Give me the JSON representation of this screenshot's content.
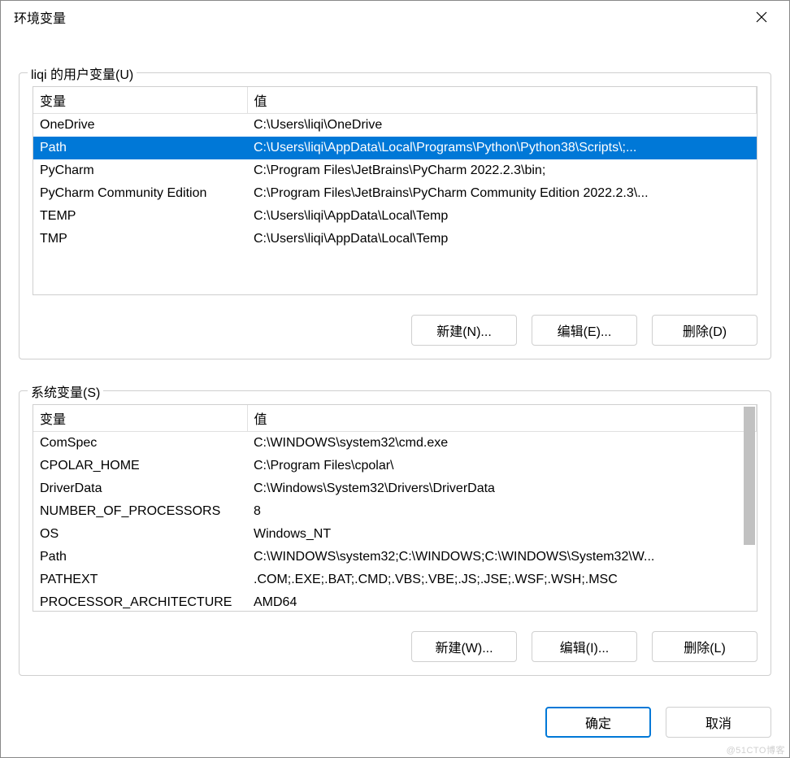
{
  "window": {
    "title": "环境变量",
    "close_icon": "close-icon"
  },
  "user_section": {
    "legend": "liqi 的用户变量(U)",
    "columns": {
      "variable": "变量",
      "value": "值"
    },
    "rows": [
      {
        "variable": "OneDrive",
        "value": "C:\\Users\\liqi\\OneDrive",
        "selected": false
      },
      {
        "variable": "Path",
        "value": "C:\\Users\\liqi\\AppData\\Local\\Programs\\Python\\Python38\\Scripts\\;...",
        "selected": true
      },
      {
        "variable": "PyCharm",
        "value": "C:\\Program Files\\JetBrains\\PyCharm 2022.2.3\\bin;",
        "selected": false
      },
      {
        "variable": "PyCharm Community Edition",
        "value": "C:\\Program Files\\JetBrains\\PyCharm Community Edition 2022.2.3\\...",
        "selected": false
      },
      {
        "variable": "TEMP",
        "value": "C:\\Users\\liqi\\AppData\\Local\\Temp",
        "selected": false
      },
      {
        "variable": "TMP",
        "value": "C:\\Users\\liqi\\AppData\\Local\\Temp",
        "selected": false
      }
    ],
    "buttons": {
      "new": "新建(N)...",
      "edit": "编辑(E)...",
      "delete": "删除(D)"
    }
  },
  "system_section": {
    "legend": "系统变量(S)",
    "columns": {
      "variable": "变量",
      "value": "值"
    },
    "rows": [
      {
        "variable": "ComSpec",
        "value": "C:\\WINDOWS\\system32\\cmd.exe"
      },
      {
        "variable": "CPOLAR_HOME",
        "value": "C:\\Program Files\\cpolar\\"
      },
      {
        "variable": "DriverData",
        "value": "C:\\Windows\\System32\\Drivers\\DriverData"
      },
      {
        "variable": "NUMBER_OF_PROCESSORS",
        "value": "8"
      },
      {
        "variable": "OS",
        "value": "Windows_NT"
      },
      {
        "variable": "Path",
        "value": "C:\\WINDOWS\\system32;C:\\WINDOWS;C:\\WINDOWS\\System32\\W..."
      },
      {
        "variable": "PATHEXT",
        "value": ".COM;.EXE;.BAT;.CMD;.VBS;.VBE;.JS;.JSE;.WSF;.WSH;.MSC"
      },
      {
        "variable": "PROCESSOR_ARCHITECTURE",
        "value": "AMD64"
      }
    ],
    "buttons": {
      "new": "新建(W)...",
      "edit": "编辑(I)...",
      "delete": "删除(L)"
    }
  },
  "dialog_buttons": {
    "ok": "确定",
    "cancel": "取消"
  },
  "watermark": "@51CTO博客"
}
